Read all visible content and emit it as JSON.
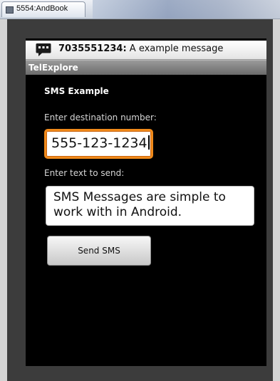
{
  "host_window": {
    "tab_title": "5554:AndBook"
  },
  "notification": {
    "icon": "sms-message-icon",
    "sender": "7035551234:",
    "message": " A example message"
  },
  "app": {
    "title": "TelExplore",
    "heading": "SMS Example",
    "destination": {
      "label": "Enter destination number:",
      "value": "555-123-1234"
    },
    "message": {
      "label": "Enter text to send:",
      "value": "SMS Messages are simple to work with in Android."
    },
    "send_button": "Send SMS"
  },
  "colors": {
    "focus_orange": "#f08a1b",
    "screen_bg": "#000000",
    "title_bar_gray": "#7e7e7e"
  }
}
